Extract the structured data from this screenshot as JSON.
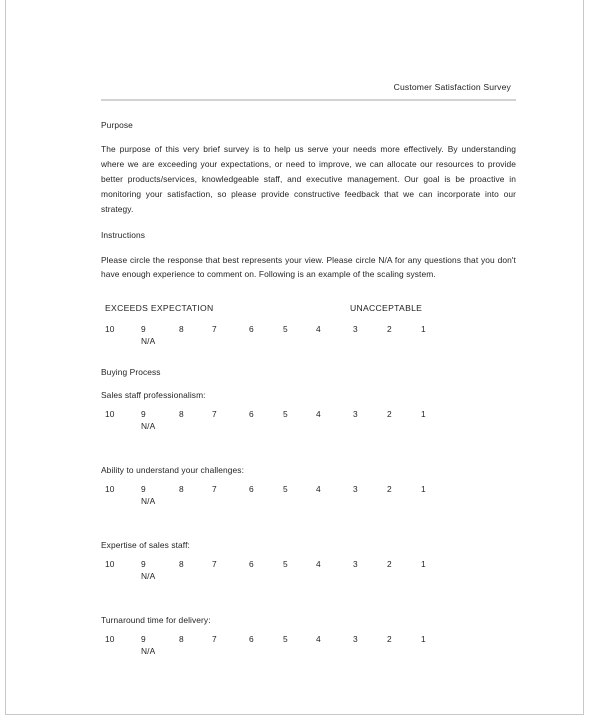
{
  "document": {
    "header_title": "Customer Satisfaction Survey",
    "sections": {
      "purpose_heading": "Purpose",
      "purpose_text": "The purpose of this very brief survey is to help us serve your needs more effectively.  By understanding where we are exceeding your expectations, or need to improve, we can allocate our resources to provide better products/services, knowledgeable staff, and executive management.   Our goal is be proactive in monitoring your satisfaction, so please provide constructive feedback that we can incorporate into our strategy.",
      "instructions_heading": "Instructions",
      "instructions_text": "Please circle the response that best represents your view.   Please circle N/A for any questions that you don't have enough experience to comment on.  Following is an example of the scaling system.",
      "group_heading": "Buying Process"
    },
    "scale": {
      "left_anchor": "EXCEEDS EXPECTATION",
      "right_anchor": "UNACCEPTABLE",
      "points": [
        "10",
        "9",
        "8",
        "7",
        "6",
        "5",
        "4",
        "3",
        "2",
        "1"
      ],
      "na_label": "N/A",
      "na_under_index": 1
    },
    "questions": [
      {
        "label": "Sales staff professionalism:"
      },
      {
        "label": "Ability to understand your challenges:"
      },
      {
        "label": "Expertise of sales staff:"
      },
      {
        "label": "Turnaround time for delivery:"
      }
    ]
  }
}
